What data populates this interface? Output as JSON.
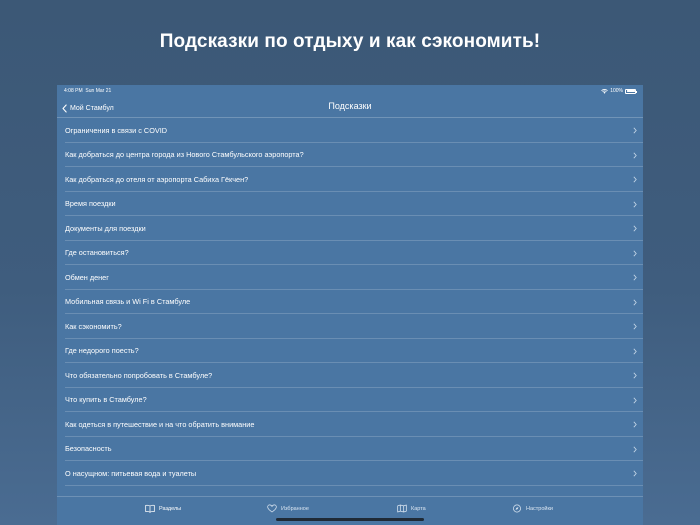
{
  "headline": "Подсказки по отдыху и как сэкономить!",
  "status": {
    "time": "4:08 PM",
    "date": "Sun Mar 21",
    "battery": "100%"
  },
  "nav": {
    "back_label": "Мой Стамбул",
    "title": "Подсказки"
  },
  "items": [
    {
      "label": "Ограничения в связи с COVID"
    },
    {
      "label": "Как добраться до центра города из Нового Стамбульского аэропорта?"
    },
    {
      "label": "Как добраться до отеля от аэропорта Сабиха Гёкчен?"
    },
    {
      "label": "Время поездки"
    },
    {
      "label": "Документы для поездки"
    },
    {
      "label": "Где остановиться?"
    },
    {
      "label": "Обмен денег"
    },
    {
      "label": "Мобильная связь и Wi Fi в Стамбуле"
    },
    {
      "label": "Как сэкономить?"
    },
    {
      "label": "Где недорого поесть?"
    },
    {
      "label": "Что обязательно попробовать в Стамбуле?"
    },
    {
      "label": "Что купить в Стамбуле?"
    },
    {
      "label": "Как одеться в путешествие и на что обратить внимание"
    },
    {
      "label": "Безопасность"
    },
    {
      "label": "О насущном: питьевая вода и туалеты"
    }
  ],
  "tabs": {
    "sections": "Разделы",
    "favorites": "Избранное",
    "map": "Карта",
    "settings": "Настройки"
  },
  "colors": {
    "background": "#3f5d7e",
    "panel": "#4a76a3",
    "text": "#ffffff"
  },
  "icons": {
    "back": "chevron-left-icon",
    "row": "chevron-right-icon",
    "sections": "book-icon",
    "favorites": "heart-icon",
    "map": "map-icon",
    "settings": "compass-icon"
  }
}
